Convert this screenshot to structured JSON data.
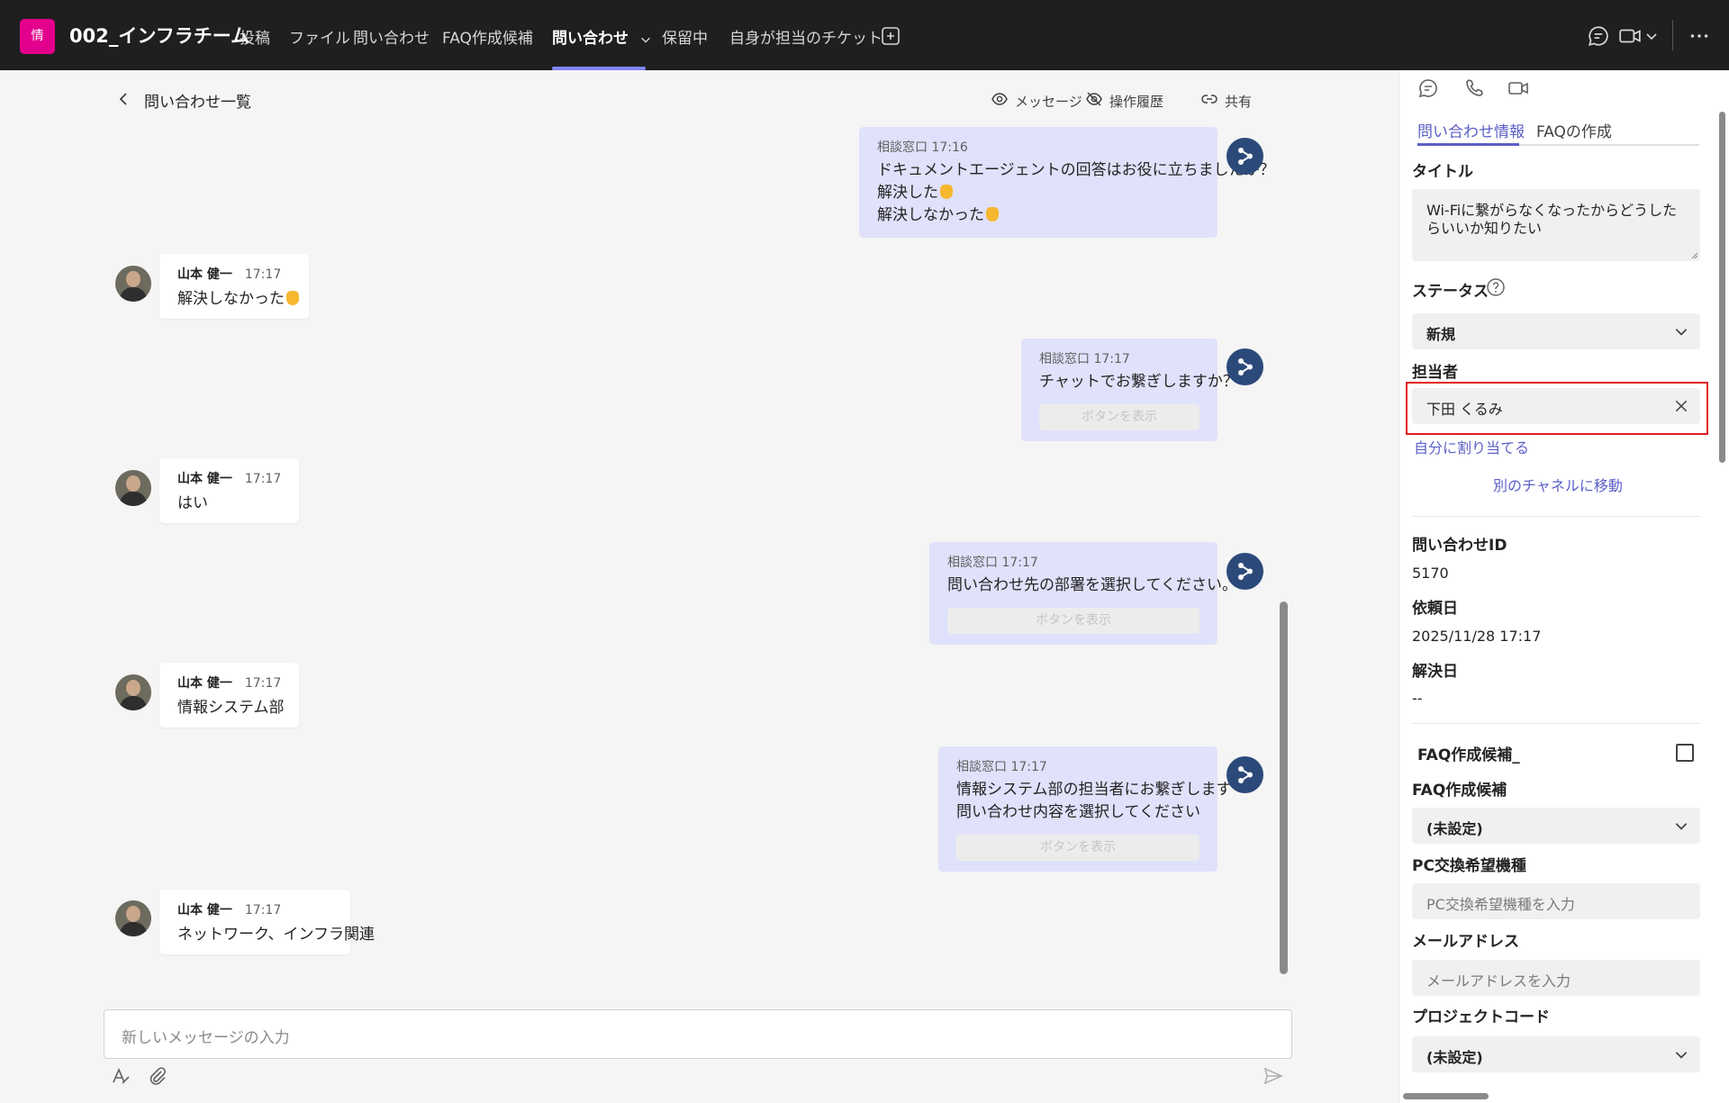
{
  "app": {
    "team_avatar_text": "情",
    "team_name": "002_インフラチーム",
    "accent_color": "#7f85f5",
    "tabs": [
      {
        "label": "投稿"
      },
      {
        "label": "ファイル"
      },
      {
        "label": "問い合わせ"
      },
      {
        "label": "FAQ作成候補"
      },
      {
        "label": "問い合わせ",
        "active": true
      },
      {
        "label": "保留中"
      },
      {
        "label": "自身が担当のチケット"
      }
    ],
    "icons": [
      "add-tab-icon",
      "chat-icon",
      "video-icon",
      "chevron-down-icon",
      "more-icon"
    ]
  },
  "subheader": {
    "back_label": "問い合わせ一覧",
    "actions": [
      {
        "label": "メッセージ",
        "icon": "eye-icon"
      },
      {
        "label": "操作履歴",
        "icon": "eye-off-icon"
      },
      {
        "label": "共有",
        "icon": "link-icon"
      }
    ]
  },
  "messages": [
    {
      "type": "bot",
      "sender": "相談窓口",
      "time": "17:16",
      "lines": [
        "ドキュメントエージェントの回答はお役に立ちましたか？",
        "解決した",
        "解決しなかった"
      ],
      "button": ""
    },
    {
      "type": "user",
      "sender": "山本 健一",
      "time": "17:17",
      "text": "解決しなかった"
    },
    {
      "type": "bot",
      "sender": "相談窓口",
      "time": "17:17",
      "lines": [
        "チャットでお繋ぎしますか？"
      ],
      "button": "ボタンを表示"
    },
    {
      "type": "user",
      "sender": "山本 健一",
      "time": "17:17",
      "text": "はい"
    },
    {
      "type": "bot",
      "sender": "相談窓口",
      "time": "17:17",
      "lines": [
        "問い合わせ先の部署を選択してください。"
      ],
      "button": "ボタンを表示"
    },
    {
      "type": "user",
      "sender": "山本 健一",
      "time": "17:17",
      "text": "情報システム部"
    },
    {
      "type": "bot",
      "sender": "相談窓口",
      "time": "17:17",
      "lines": [
        "情報システム部の担当者にお繋ぎします",
        "問い合わせ内容を選択してください"
      ],
      "button": "ボタンを表示"
    },
    {
      "type": "user",
      "sender": "山本 健一",
      "time": "17:17",
      "text": "ネットワーク、インフラ関連"
    }
  ],
  "compose": {
    "placeholder": "新しいメッセージの入力"
  },
  "panel": {
    "tabs": [
      {
        "label": "問い合わせ情報",
        "active": true
      },
      {
        "label": "FAQの作成"
      }
    ],
    "title_label": "タイトル",
    "title_value": "Wi-Fiに繋がらなくなったからどうしたらいいか知りたい",
    "status_label": "ステータス",
    "status_value": "新規",
    "assignee_label": "担当者",
    "assignee_value": "下田 くるみ",
    "assign_self_link": "自分に割り当てる",
    "move_channel_link": "別のチャネルに移動",
    "inquiry_id_label": "問い合わせID",
    "inquiry_id_value": "5170",
    "request_date_label": "依頼日",
    "request_date_value": "2025/11/28 17:17",
    "resolved_date_label": "解決日",
    "resolved_date_value": "--",
    "faq_candidate_check_label": "FAQ作成候補_",
    "faq_candidate_label": "FAQ作成候補",
    "faq_candidate_value": "(未設定)",
    "pc_model_label": "PC交換希望機種",
    "pc_model_placeholder": "PC交換希望機種を入力",
    "email_label": "メールアドレス",
    "email_placeholder": "メールアドレスを入力",
    "project_code_label": "プロジェクトコード",
    "project_code_value": "(未設定)"
  }
}
